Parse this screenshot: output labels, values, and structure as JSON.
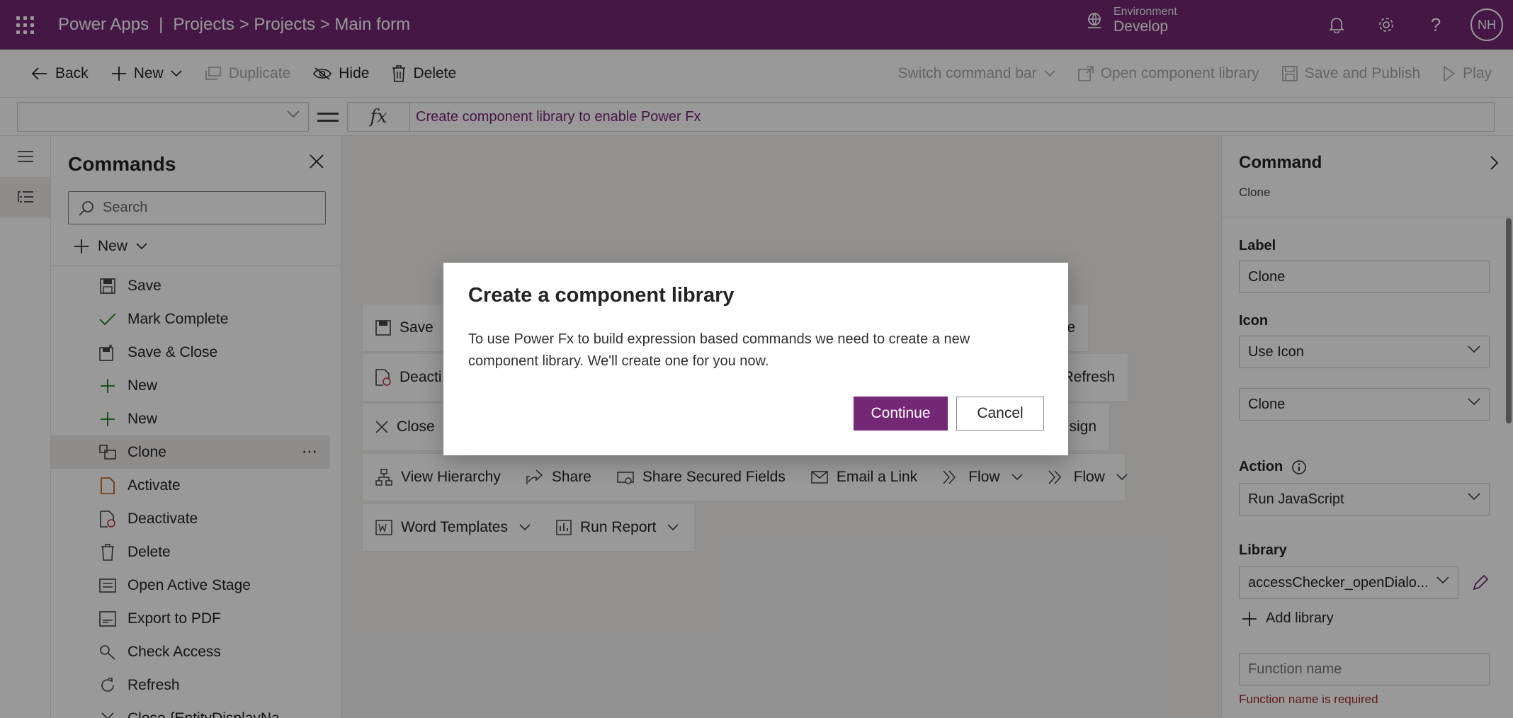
{
  "header": {
    "app_name": "Power Apps",
    "separator": "|",
    "breadcrumb": "Projects > Projects > Main form",
    "environment_label": "Environment",
    "environment_name": "Develop",
    "user_initials": "NH"
  },
  "toolbar": {
    "back": "Back",
    "new": "New",
    "duplicate": "Duplicate",
    "hide": "Hide",
    "delete": "Delete",
    "switch_command_bar": "Switch command bar",
    "open_component_library": "Open component library",
    "save_and_publish": "Save and Publish",
    "play": "Play"
  },
  "formula_bar": {
    "fx": "fx",
    "text": "Create component library to enable Power Fx"
  },
  "commands_panel": {
    "title": "Commands",
    "search_placeholder": "Search",
    "new_label": "New",
    "items": [
      {
        "label": "Save",
        "icon": "save-icon"
      },
      {
        "label": "Mark Complete",
        "icon": "checkmark-icon"
      },
      {
        "label": "Save & Close",
        "icon": "save-close-icon"
      },
      {
        "label": "New",
        "icon": "plus-icon"
      },
      {
        "label": "New",
        "icon": "plus-icon"
      },
      {
        "label": "Clone",
        "icon": "clone-icon",
        "selected": true
      },
      {
        "label": "Activate",
        "icon": "activate-icon"
      },
      {
        "label": "Deactivate",
        "icon": "deactivate-icon"
      },
      {
        "label": "Delete",
        "icon": "trash-icon"
      },
      {
        "label": "Open Active Stage",
        "icon": "stage-icon"
      },
      {
        "label": "Export to PDF",
        "icon": "pdf-icon"
      },
      {
        "label": "Check Access",
        "icon": "key-icon"
      },
      {
        "label": "Refresh",
        "icon": "refresh-icon"
      },
      {
        "label": "Close {EntityDisplayNa...",
        "icon": "close-icon"
      }
    ]
  },
  "preview": {
    "row1": {
      "save": "Save",
      "right_partial": "e"
    },
    "row2": {
      "deactivate": "Deacti",
      "refresh": "Refresh"
    },
    "row3": {
      "close": "Close",
      "assign": "sign"
    },
    "row4": {
      "view_hierarchy": "View Hierarchy",
      "share": "Share",
      "share_secured": "Share Secured Fields",
      "email_link": "Email a Link",
      "flow1": "Flow",
      "flow2": "Flow"
    },
    "row5": {
      "word_templates": "Word Templates",
      "run_report": "Run Report"
    }
  },
  "command_panel": {
    "title": "Command",
    "subtitle": "Clone",
    "label_heading": "Label",
    "label_value": "Clone",
    "icon_heading": "Icon",
    "icon_mode": "Use Icon",
    "icon_value": "Clone",
    "action_heading": "Action",
    "action_value": "Run JavaScript",
    "library_heading": "Library",
    "library_value": "accessChecker_openDialo...",
    "add_library": "Add library",
    "function_placeholder": "Function name",
    "function_error": "Function name is required"
  },
  "dialog": {
    "title": "Create a component library",
    "body": "To use Power Fx to build expression based commands we need to create a new component library. We'll create one for you now.",
    "continue": "Continue",
    "cancel": "Cancel"
  },
  "colors": {
    "brand": "#742774",
    "error": "#a4262c"
  }
}
